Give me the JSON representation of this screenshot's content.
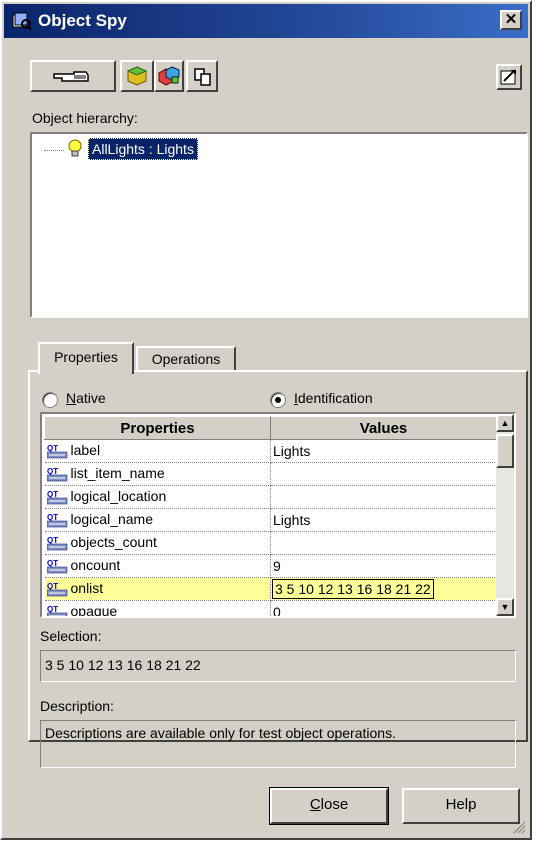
{
  "window": {
    "title": "Object Spy",
    "close_glyph": "✕"
  },
  "toolbar": {
    "pointing_hand_icon": "pointing-hand-icon",
    "run_time_object_icon": "run-time-object-icon",
    "test_object_icon": "test-object-icon",
    "copy_icon": "copy-icon",
    "keep_on_top_icon": "keep-on-top-icon"
  },
  "hierarchy": {
    "label": "Object hierarchy:",
    "items": [
      {
        "label": "AllLights : Lights",
        "icon": "lightbulb-icon",
        "selected": true
      }
    ]
  },
  "tabs": [
    {
      "label": "Properties",
      "active": true
    },
    {
      "label": "Operations",
      "active": false
    }
  ],
  "radios": [
    {
      "label": "Native",
      "underline": "N",
      "checked": false
    },
    {
      "label": "Identification",
      "underline": "I",
      "checked": true
    }
  ],
  "grid": {
    "headers": [
      "Properties",
      "Values"
    ],
    "rows": [
      {
        "property": "label",
        "value": "Lights",
        "highlight": false
      },
      {
        "property": "list_item_name",
        "value": "",
        "highlight": false
      },
      {
        "property": "logical_location",
        "value": "",
        "highlight": false
      },
      {
        "property": "logical_name",
        "value": "Lights",
        "highlight": false
      },
      {
        "property": "objects_count",
        "value": "",
        "highlight": false
      },
      {
        "property": "oncount",
        "value": "9",
        "highlight": false
      },
      {
        "property": "onlist",
        "value": "3 5 10 12 13 16 18 21 22",
        "highlight": true
      },
      {
        "property": "opaque",
        "value": "0",
        "highlight": false
      }
    ]
  },
  "selection": {
    "label": "Selection:",
    "value": "3 5 10 12 13 16 18 21 22"
  },
  "description": {
    "label": "Description:",
    "value": "Descriptions are available only for test object operations."
  },
  "buttons": {
    "close": "Close",
    "help": "Help"
  },
  "colors": {
    "title_bar": "#0a246a",
    "highlight_row": "#ffff99",
    "selection_bg": "#0a246a",
    "dialog_bg": "#d4d0c8"
  }
}
